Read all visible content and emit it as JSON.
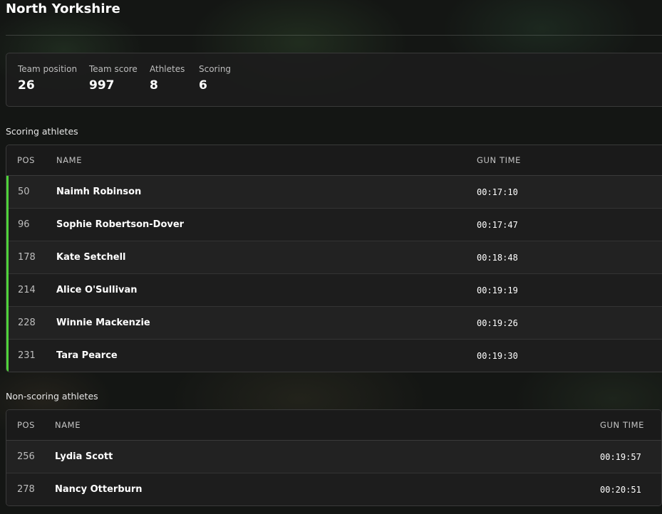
{
  "page": {
    "title": "North Yorkshire"
  },
  "summary": {
    "team_position": {
      "label": "Team position",
      "value": "26"
    },
    "team_score": {
      "label": "Team score",
      "value": "997"
    },
    "athletes": {
      "label": "Athletes",
      "value": "8"
    },
    "scoring": {
      "label": "Scoring",
      "value": "6"
    }
  },
  "scoring_section": {
    "heading": "Scoring athletes",
    "columns": {
      "pos": "POS",
      "name": "NAME",
      "gun_time": "GUN TIME"
    },
    "rows": [
      {
        "pos": "50",
        "name": "Naimh Robinson",
        "gun_time": "00:17:10"
      },
      {
        "pos": "96",
        "name": "Sophie Robertson-Dover",
        "gun_time": "00:17:47"
      },
      {
        "pos": "178",
        "name": "Kate Setchell",
        "gun_time": "00:18:48"
      },
      {
        "pos": "214",
        "name": "Alice O'Sullivan",
        "gun_time": "00:19:19"
      },
      {
        "pos": "228",
        "name": "Winnie Mackenzie",
        "gun_time": "00:19:26"
      },
      {
        "pos": "231",
        "name": "Tara Pearce",
        "gun_time": "00:19:30"
      }
    ]
  },
  "non_scoring_section": {
    "heading": "Non-scoring athletes",
    "columns": {
      "pos": "POS",
      "name": "NAME",
      "gun_time": "GUN TIME"
    },
    "rows": [
      {
        "pos": "256",
        "name": "Lydia Scott",
        "gun_time": "00:19:57"
      },
      {
        "pos": "278",
        "name": "Nancy Otterburn",
        "gun_time": "00:20:51"
      }
    ]
  },
  "colors": {
    "scoring_accent": "#4fd33a",
    "card_background": "#1f1f1f",
    "border": "#3a3a3a"
  }
}
